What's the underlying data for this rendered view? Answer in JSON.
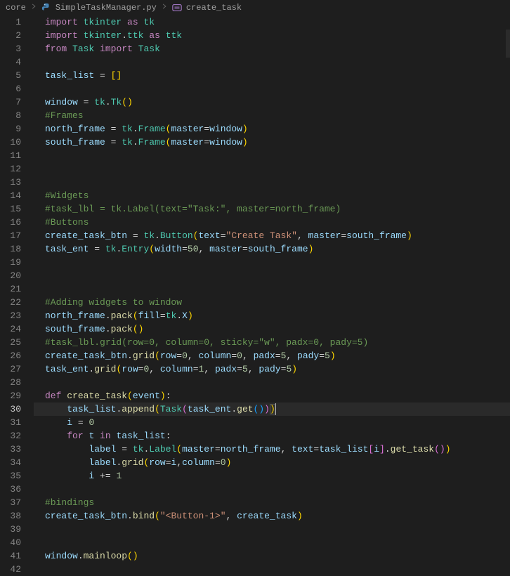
{
  "breadcrumb": {
    "folder": "core",
    "file": "SimpleTaskManager.py",
    "symbol": "create_task"
  },
  "active_line": 30,
  "lines": [
    {
      "n": 1,
      "seg": [
        [
          "kw",
          "import"
        ],
        [
          "op",
          " "
        ],
        [
          "mod",
          "tkinter"
        ],
        [
          "op",
          " "
        ],
        [
          "kw",
          "as"
        ],
        [
          "op",
          " "
        ],
        [
          "mod",
          "tk"
        ]
      ]
    },
    {
      "n": 2,
      "seg": [
        [
          "kw",
          "import"
        ],
        [
          "op",
          " "
        ],
        [
          "mod",
          "tkinter"
        ],
        [
          "op",
          "."
        ],
        [
          "mod",
          "ttk"
        ],
        [
          "op",
          " "
        ],
        [
          "kw",
          "as"
        ],
        [
          "op",
          " "
        ],
        [
          "mod",
          "ttk"
        ]
      ]
    },
    {
      "n": 3,
      "seg": [
        [
          "kw",
          "from"
        ],
        [
          "op",
          " "
        ],
        [
          "mod",
          "Task"
        ],
        [
          "op",
          " "
        ],
        [
          "kw",
          "import"
        ],
        [
          "op",
          " "
        ],
        [
          "cls",
          "Task"
        ]
      ]
    },
    {
      "n": 4,
      "seg": []
    },
    {
      "n": 5,
      "seg": [
        [
          "var",
          "task_list"
        ],
        [
          "op",
          " = "
        ],
        [
          "brk-y",
          "["
        ],
        [
          "brk-y",
          "]"
        ]
      ]
    },
    {
      "n": 6,
      "seg": []
    },
    {
      "n": 7,
      "seg": [
        [
          "var",
          "window"
        ],
        [
          "op",
          " = "
        ],
        [
          "mod",
          "tk"
        ],
        [
          "op",
          "."
        ],
        [
          "cls",
          "Tk"
        ],
        [
          "brk-y",
          "("
        ],
        [
          "brk-y",
          ")"
        ]
      ]
    },
    {
      "n": 8,
      "seg": [
        [
          "cmt",
          "#Frames"
        ]
      ]
    },
    {
      "n": 9,
      "seg": [
        [
          "var",
          "north_frame"
        ],
        [
          "op",
          " = "
        ],
        [
          "mod",
          "tk"
        ],
        [
          "op",
          "."
        ],
        [
          "cls",
          "Frame"
        ],
        [
          "brk-y",
          "("
        ],
        [
          "prm",
          "master"
        ],
        [
          "op",
          "="
        ],
        [
          "var",
          "window"
        ],
        [
          "brk-y",
          ")"
        ]
      ]
    },
    {
      "n": 10,
      "seg": [
        [
          "var",
          "south_frame"
        ],
        [
          "op",
          " = "
        ],
        [
          "mod",
          "tk"
        ],
        [
          "op",
          "."
        ],
        [
          "cls",
          "Frame"
        ],
        [
          "brk-y",
          "("
        ],
        [
          "prm",
          "master"
        ],
        [
          "op",
          "="
        ],
        [
          "var",
          "window"
        ],
        [
          "brk-y",
          ")"
        ]
      ]
    },
    {
      "n": 11,
      "seg": []
    },
    {
      "n": 12,
      "seg": []
    },
    {
      "n": 13,
      "seg": []
    },
    {
      "n": 14,
      "seg": [
        [
          "cmt",
          "#Widgets"
        ]
      ]
    },
    {
      "n": 15,
      "seg": [
        [
          "cmt",
          "#task_lbl = tk.Label(text=\"Task:\", master=north_frame)"
        ]
      ]
    },
    {
      "n": 16,
      "seg": [
        [
          "cmt",
          "#Buttons"
        ]
      ]
    },
    {
      "n": 17,
      "seg": [
        [
          "var",
          "create_task_btn"
        ],
        [
          "op",
          " = "
        ],
        [
          "mod",
          "tk"
        ],
        [
          "op",
          "."
        ],
        [
          "cls",
          "Button"
        ],
        [
          "brk-y",
          "("
        ],
        [
          "prm",
          "text"
        ],
        [
          "op",
          "="
        ],
        [
          "str",
          "\"Create Task\""
        ],
        [
          "op",
          ", "
        ],
        [
          "prm",
          "master"
        ],
        [
          "op",
          "="
        ],
        [
          "var",
          "south_frame"
        ],
        [
          "brk-y",
          ")"
        ]
      ]
    },
    {
      "n": 18,
      "seg": [
        [
          "var",
          "task_ent"
        ],
        [
          "op",
          " = "
        ],
        [
          "mod",
          "tk"
        ],
        [
          "op",
          "."
        ],
        [
          "cls",
          "Entry"
        ],
        [
          "brk-y",
          "("
        ],
        [
          "prm",
          "width"
        ],
        [
          "op",
          "="
        ],
        [
          "num",
          "50"
        ],
        [
          "op",
          ", "
        ],
        [
          "prm",
          "master"
        ],
        [
          "op",
          "="
        ],
        [
          "var",
          "south_frame"
        ],
        [
          "brk-y",
          ")"
        ]
      ]
    },
    {
      "n": 19,
      "seg": []
    },
    {
      "n": 20,
      "seg": []
    },
    {
      "n": 21,
      "seg": []
    },
    {
      "n": 22,
      "seg": [
        [
          "cmt",
          "#Adding widgets to window"
        ]
      ]
    },
    {
      "n": 23,
      "seg": [
        [
          "var",
          "north_frame"
        ],
        [
          "op",
          "."
        ],
        [
          "fn",
          "pack"
        ],
        [
          "brk-y",
          "("
        ],
        [
          "prm",
          "fill"
        ],
        [
          "op",
          "="
        ],
        [
          "mod",
          "tk"
        ],
        [
          "op",
          "."
        ],
        [
          "var",
          "X"
        ],
        [
          "brk-y",
          ")"
        ]
      ]
    },
    {
      "n": 24,
      "seg": [
        [
          "var",
          "south_frame"
        ],
        [
          "op",
          "."
        ],
        [
          "fn",
          "pack"
        ],
        [
          "brk-y",
          "("
        ],
        [
          "brk-y",
          ")"
        ]
      ]
    },
    {
      "n": 25,
      "seg": [
        [
          "cmt",
          "#task_lbl.grid(row=0, column=0, sticky=\"w\", padx=0, pady=5)"
        ]
      ]
    },
    {
      "n": 26,
      "seg": [
        [
          "var",
          "create_task_btn"
        ],
        [
          "op",
          "."
        ],
        [
          "fn",
          "grid"
        ],
        [
          "brk-y",
          "("
        ],
        [
          "prm",
          "row"
        ],
        [
          "op",
          "="
        ],
        [
          "num",
          "0"
        ],
        [
          "op",
          ", "
        ],
        [
          "prm",
          "column"
        ],
        [
          "op",
          "="
        ],
        [
          "num",
          "0"
        ],
        [
          "op",
          ", "
        ],
        [
          "prm",
          "padx"
        ],
        [
          "op",
          "="
        ],
        [
          "num",
          "5"
        ],
        [
          "op",
          ", "
        ],
        [
          "prm",
          "pady"
        ],
        [
          "op",
          "="
        ],
        [
          "num",
          "5"
        ],
        [
          "brk-y",
          ")"
        ]
      ]
    },
    {
      "n": 27,
      "seg": [
        [
          "var",
          "task_ent"
        ],
        [
          "op",
          "."
        ],
        [
          "fn",
          "grid"
        ],
        [
          "brk-y",
          "("
        ],
        [
          "prm",
          "row"
        ],
        [
          "op",
          "="
        ],
        [
          "num",
          "0"
        ],
        [
          "op",
          ", "
        ],
        [
          "prm",
          "column"
        ],
        [
          "op",
          "="
        ],
        [
          "num",
          "1"
        ],
        [
          "op",
          ", "
        ],
        [
          "prm",
          "padx"
        ],
        [
          "op",
          "="
        ],
        [
          "num",
          "5"
        ],
        [
          "op",
          ", "
        ],
        [
          "prm",
          "pady"
        ],
        [
          "op",
          "="
        ],
        [
          "num",
          "5"
        ],
        [
          "brk-y",
          ")"
        ]
      ]
    },
    {
      "n": 28,
      "seg": []
    },
    {
      "n": 29,
      "seg": [
        [
          "kw",
          "def"
        ],
        [
          "op",
          " "
        ],
        [
          "fn",
          "create_task"
        ],
        [
          "brk-y",
          "("
        ],
        [
          "var",
          "event"
        ],
        [
          "brk-y",
          ")"
        ],
        [
          "op",
          ":"
        ]
      ]
    },
    {
      "n": 30,
      "hl": true,
      "seg": [
        [
          "op",
          "    "
        ],
        [
          "var",
          "task_list"
        ],
        [
          "op",
          "."
        ],
        [
          "fn",
          "append"
        ],
        [
          "brk-y",
          "("
        ],
        [
          "cls",
          "Task"
        ],
        [
          "brk-p",
          "("
        ],
        [
          "var",
          "task_ent"
        ],
        [
          "op",
          "."
        ],
        [
          "fn",
          "get"
        ],
        [
          "brk-b",
          "("
        ],
        [
          "brk-b",
          ")"
        ],
        [
          "brk-p",
          ")"
        ],
        [
          "brk-y",
          ")",
          true
        ]
      ]
    },
    {
      "n": 31,
      "seg": [
        [
          "op",
          "    "
        ],
        [
          "var",
          "i"
        ],
        [
          "op",
          " = "
        ],
        [
          "num",
          "0"
        ]
      ]
    },
    {
      "n": 32,
      "seg": [
        [
          "op",
          "    "
        ],
        [
          "kw",
          "for"
        ],
        [
          "op",
          " "
        ],
        [
          "var",
          "t"
        ],
        [
          "op",
          " "
        ],
        [
          "kw",
          "in"
        ],
        [
          "op",
          " "
        ],
        [
          "var",
          "task_list"
        ],
        [
          "op",
          ":"
        ]
      ]
    },
    {
      "n": 33,
      "seg": [
        [
          "op",
          "        "
        ],
        [
          "var",
          "label"
        ],
        [
          "op",
          " = "
        ],
        [
          "mod",
          "tk"
        ],
        [
          "op",
          "."
        ],
        [
          "cls",
          "Label"
        ],
        [
          "brk-y",
          "("
        ],
        [
          "prm",
          "master"
        ],
        [
          "op",
          "="
        ],
        [
          "var",
          "north_frame"
        ],
        [
          "op",
          ", "
        ],
        [
          "prm",
          "text"
        ],
        [
          "op",
          "="
        ],
        [
          "var",
          "task_list"
        ],
        [
          "brk-p",
          "["
        ],
        [
          "var",
          "i"
        ],
        [
          "brk-p",
          "]"
        ],
        [
          "op",
          "."
        ],
        [
          "fn",
          "get_task"
        ],
        [
          "brk-p",
          "("
        ],
        [
          "brk-p",
          ")"
        ],
        [
          "brk-y",
          ")"
        ]
      ]
    },
    {
      "n": 34,
      "seg": [
        [
          "op",
          "        "
        ],
        [
          "var",
          "label"
        ],
        [
          "op",
          "."
        ],
        [
          "fn",
          "grid"
        ],
        [
          "brk-y",
          "("
        ],
        [
          "prm",
          "row"
        ],
        [
          "op",
          "="
        ],
        [
          "var",
          "i"
        ],
        [
          "op",
          ","
        ],
        [
          "prm",
          "column"
        ],
        [
          "op",
          "="
        ],
        [
          "num",
          "0"
        ],
        [
          "brk-y",
          ")"
        ]
      ]
    },
    {
      "n": 35,
      "seg": [
        [
          "op",
          "        "
        ],
        [
          "var",
          "i"
        ],
        [
          "op",
          " += "
        ],
        [
          "num",
          "1"
        ]
      ]
    },
    {
      "n": 36,
      "seg": []
    },
    {
      "n": 37,
      "seg": [
        [
          "cmt",
          "#bindings"
        ]
      ]
    },
    {
      "n": 38,
      "seg": [
        [
          "var",
          "create_task_btn"
        ],
        [
          "op",
          "."
        ],
        [
          "fn",
          "bind"
        ],
        [
          "brk-y",
          "("
        ],
        [
          "str",
          "\"<Button-1>\""
        ],
        [
          "op",
          ", "
        ],
        [
          "var",
          "create_task"
        ],
        [
          "brk-y",
          ")"
        ]
      ]
    },
    {
      "n": 39,
      "seg": []
    },
    {
      "n": 40,
      "seg": []
    },
    {
      "n": 41,
      "seg": [
        [
          "var",
          "window"
        ],
        [
          "op",
          "."
        ],
        [
          "fn",
          "mainloop"
        ],
        [
          "brk-y",
          "("
        ],
        [
          "brk-y",
          ")"
        ]
      ]
    },
    {
      "n": 42,
      "seg": []
    }
  ]
}
